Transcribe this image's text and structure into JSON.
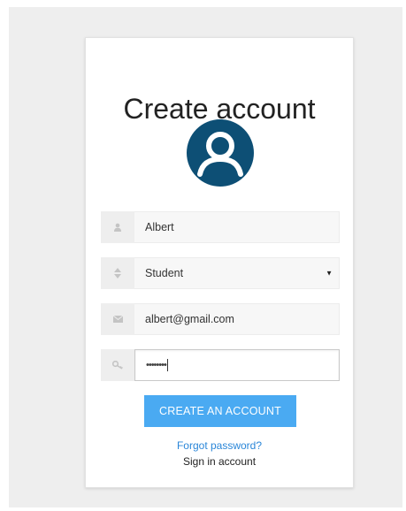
{
  "form": {
    "title": "Create account",
    "name_value": "Albert",
    "role_value": "Student",
    "email_value": "albert@gmail.com",
    "password_value": "••••••••",
    "submit_label": "CREATE AN ACCOUNT",
    "forgot_label": "Forgot password?",
    "signin_label": "Sign in account"
  },
  "icons": {
    "avatar": "user-circle-icon",
    "name": "user-icon",
    "role": "sort-icon",
    "email": "envelope-icon",
    "password": "key-icon",
    "select": "caret-down-icon"
  },
  "colors": {
    "accent": "#4aaaf2",
    "avatar": "#0d4f75",
    "link": "#2a86d8"
  }
}
